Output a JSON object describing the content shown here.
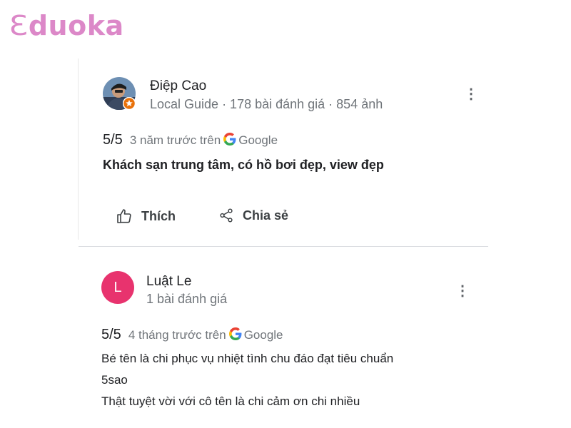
{
  "brand": {
    "logo_mark": "Ɛ",
    "logo_text": "duoka",
    "color": "#dc88c8"
  },
  "reviews": [
    {
      "author": "Điệp Cao",
      "author_meta": "Local Guide · 178 bài đánh giá · 854 ảnh",
      "avatar_type": "photo",
      "badge_icon": "local-guide-star-icon",
      "score": "5/5",
      "when": "3 năm trước trên",
      "source": "Google",
      "text_bold": "Khách sạn trung tâm, có hồ bơi đẹp, view đẹp",
      "actions": {
        "like": "Thích",
        "share": "Chia sẻ"
      },
      "menu_icon": "more-vertical-icon"
    },
    {
      "author": "Luật Le",
      "author_meta": "1 bài đánh giá",
      "avatar_type": "letter",
      "avatar_letter": "L",
      "avatar_color": "#e8336e",
      "score": "5/5",
      "when": "4 tháng trước trên",
      "source": "Google",
      "text_lines": [
        "Bé tên là chi phục vụ nhiệt tình chu đáo đạt tiêu chuẩn",
        "5sao",
        "Thật tuyệt vời với cô tên là chi cảm ơn chi nhiều"
      ],
      "menu_icon": "more-vertical-icon"
    }
  ]
}
